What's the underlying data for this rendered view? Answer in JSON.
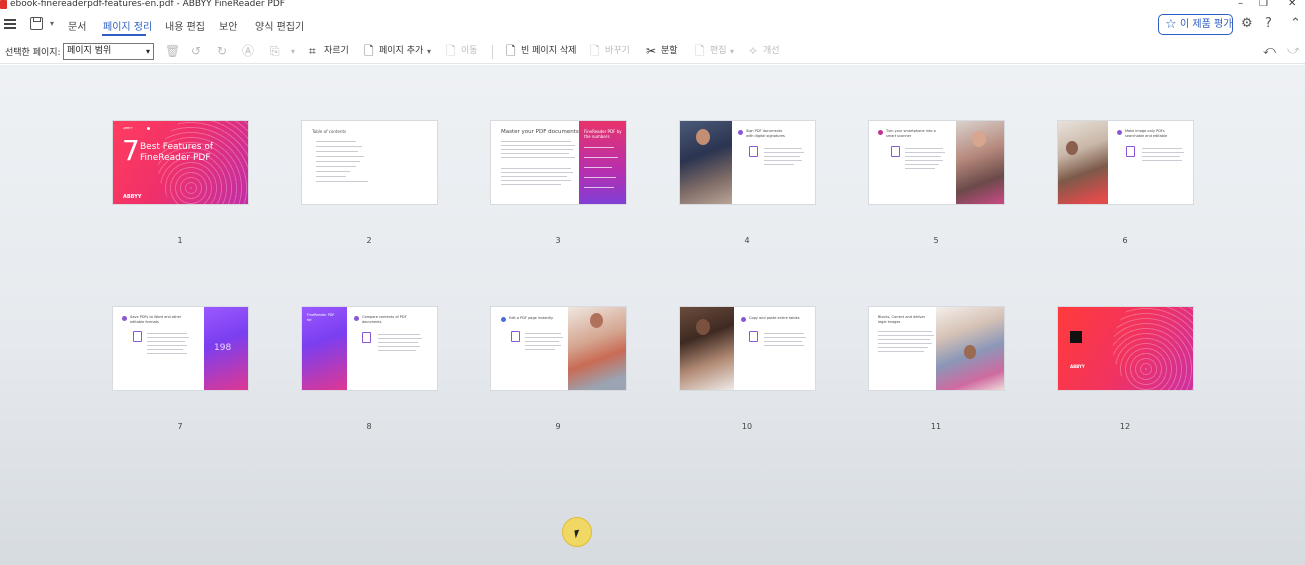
{
  "window": {
    "title": "ebook-finereaderpdf-features-en.pdf - ABBYY FineReader PDF",
    "controls": [
      "–",
      "❐",
      "✕"
    ]
  },
  "tabs": {
    "items": [
      {
        "label": "문서"
      },
      {
        "label": "페이지 정리"
      },
      {
        "label": "내용 편집"
      },
      {
        "label": "보안"
      },
      {
        "label": "양식 편집기"
      }
    ],
    "active": "페이지 정리"
  },
  "header_right": {
    "rate_button": "이 제품 평가",
    "icons": [
      "star-icon",
      "gear-icon",
      "help-icon",
      "chevron-up-icon"
    ]
  },
  "toolbar": {
    "selected_pages_label": "선택한 페이지:",
    "page_range_value": "페이지 범위",
    "crop": "자르기",
    "add_page": "페이지 추가",
    "move": "이동",
    "delete_blank": "빈 페이지 삭제",
    "replace": "바꾸기",
    "split": "분할",
    "edit": "편집",
    "improve": "개선"
  },
  "pages": [
    {
      "number": "1",
      "title": "Best Features of FineReader PDF",
      "big": "7",
      "brand": "ABBYY"
    },
    {
      "number": "2",
      "title": "Table of contents"
    },
    {
      "number": "3",
      "title": "Master your PDF documents",
      "side": "FineReader PDF by the numbers"
    },
    {
      "number": "4",
      "title": "Sign PDF documents with digital signatures"
    },
    {
      "number": "5",
      "title": "Turn your smartphone into a smart scanner"
    },
    {
      "number": "6",
      "title": "Make image-only PDFs searchable and editable"
    },
    {
      "number": "7",
      "title": "Save PDFs to Word and other editable formats",
      "side": "198"
    },
    {
      "number": "8",
      "title": "Compare contents of PDF documents",
      "side": "FineReader PDF for"
    },
    {
      "number": "9",
      "title": "Edit a PDF page instantly"
    },
    {
      "number": "10",
      "title": "Copy and paste entire tables"
    },
    {
      "number": "11",
      "title": "Blocks, Correct and deliver legal images"
    },
    {
      "number": "12",
      "brand": "ABBYY"
    }
  ],
  "colors": {
    "accent": "#2f5ec4",
    "workspace_bg": "#eef1f4",
    "cover_pink": "#f0306a",
    "purple": "#7b3ff0"
  }
}
